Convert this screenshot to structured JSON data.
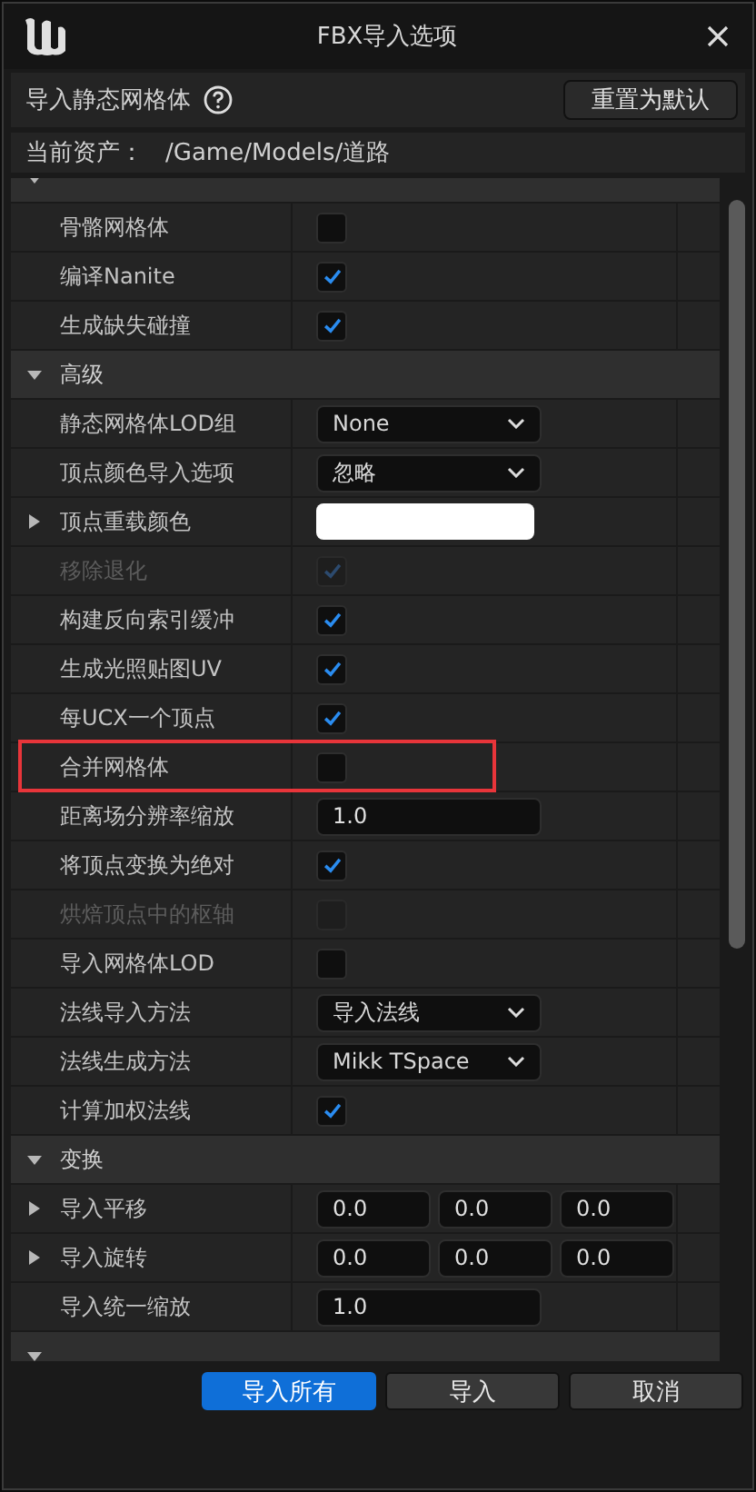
{
  "window": {
    "title": "FBX导入选项"
  },
  "header": {
    "title": "导入静态网格体",
    "reset_button": "重置为默认"
  },
  "asset": {
    "label": "当前资产：",
    "path": "/Game/Models/道路"
  },
  "properties": [
    {
      "kind": "section",
      "expanded": true
    },
    {
      "kind": "checkbox",
      "label": "骨骼网格体",
      "checked": false,
      "disabled": false,
      "expandable": false,
      "highlighted": false
    },
    {
      "kind": "checkbox",
      "label": "编译Nanite",
      "checked": true,
      "disabled": false,
      "expandable": false,
      "highlighted": false
    },
    {
      "kind": "checkbox",
      "label": "生成缺失碰撞",
      "checked": true,
      "disabled": false,
      "expandable": false,
      "highlighted": false
    },
    {
      "kind": "section",
      "label": "高级",
      "expanded": true
    },
    {
      "kind": "dropdown",
      "label": "静态网格体LOD组",
      "value": "None",
      "disabled": false,
      "expandable": false,
      "highlighted": false
    },
    {
      "kind": "dropdown",
      "label": "顶点颜色导入选项",
      "value": "忽略",
      "disabled": false,
      "expandable": false,
      "highlighted": false
    },
    {
      "kind": "color",
      "label": "顶点重载颜色",
      "color": "#ffffff",
      "disabled": false,
      "expandable": true,
      "highlighted": false
    },
    {
      "kind": "checkbox",
      "label": "移除退化",
      "checked": true,
      "disabled": true,
      "expandable": false,
      "highlighted": false
    },
    {
      "kind": "checkbox",
      "label": "构建反向索引缓冲",
      "checked": true,
      "disabled": false,
      "expandable": false,
      "highlighted": false
    },
    {
      "kind": "checkbox",
      "label": "生成光照贴图UV",
      "checked": true,
      "disabled": false,
      "expandable": false,
      "highlighted": false
    },
    {
      "kind": "checkbox",
      "label": "每UCX一个顶点",
      "checked": true,
      "disabled": false,
      "expandable": false,
      "highlighted": false
    },
    {
      "kind": "checkbox",
      "label": "合并网格体",
      "checked": false,
      "disabled": false,
      "expandable": false,
      "highlighted": true
    },
    {
      "kind": "number",
      "label": "距离场分辨率缩放",
      "value": "1.0",
      "disabled": false,
      "expandable": false,
      "highlighted": false
    },
    {
      "kind": "checkbox",
      "label": "将顶点变换为绝对",
      "checked": true,
      "disabled": false,
      "expandable": false,
      "highlighted": false
    },
    {
      "kind": "checkbox",
      "label": "烘焙顶点中的枢轴",
      "checked": false,
      "disabled": true,
      "expandable": false,
      "highlighted": false
    },
    {
      "kind": "checkbox",
      "label": "导入网格体LOD",
      "checked": false,
      "disabled": false,
      "expandable": false,
      "highlighted": false
    },
    {
      "kind": "dropdown",
      "label": "法线导入方法",
      "value": "导入法线",
      "disabled": false,
      "expandable": false,
      "highlighted": false
    },
    {
      "kind": "dropdown",
      "label": "法线生成方法",
      "value": "Mikk TSpace",
      "disabled": false,
      "expandable": false,
      "highlighted": false
    },
    {
      "kind": "checkbox",
      "label": "计算加权法线",
      "checked": true,
      "disabled": false,
      "expandable": false,
      "highlighted": false
    },
    {
      "kind": "section",
      "label": "变换",
      "expanded": true
    },
    {
      "kind": "vector",
      "label": "导入平移",
      "values": [
        "0.0",
        "0.0",
        "0.0"
      ],
      "disabled": false,
      "expandable": true,
      "highlighted": false
    },
    {
      "kind": "vector",
      "label": "导入旋转",
      "values": [
        "0.0",
        "0.0",
        "0.0"
      ],
      "disabled": false,
      "expandable": true,
      "highlighted": false
    },
    {
      "kind": "number",
      "label": "导入统一缩放",
      "value": "1.0",
      "disabled": false,
      "expandable": false,
      "highlighted": false
    },
    {
      "kind": "section",
      "expanded": true
    }
  ],
  "buttons": [
    {
      "label": "导入所有",
      "primary": true
    },
    {
      "label": "导入",
      "primary": false
    },
    {
      "label": "取消",
      "primary": false
    }
  ]
}
